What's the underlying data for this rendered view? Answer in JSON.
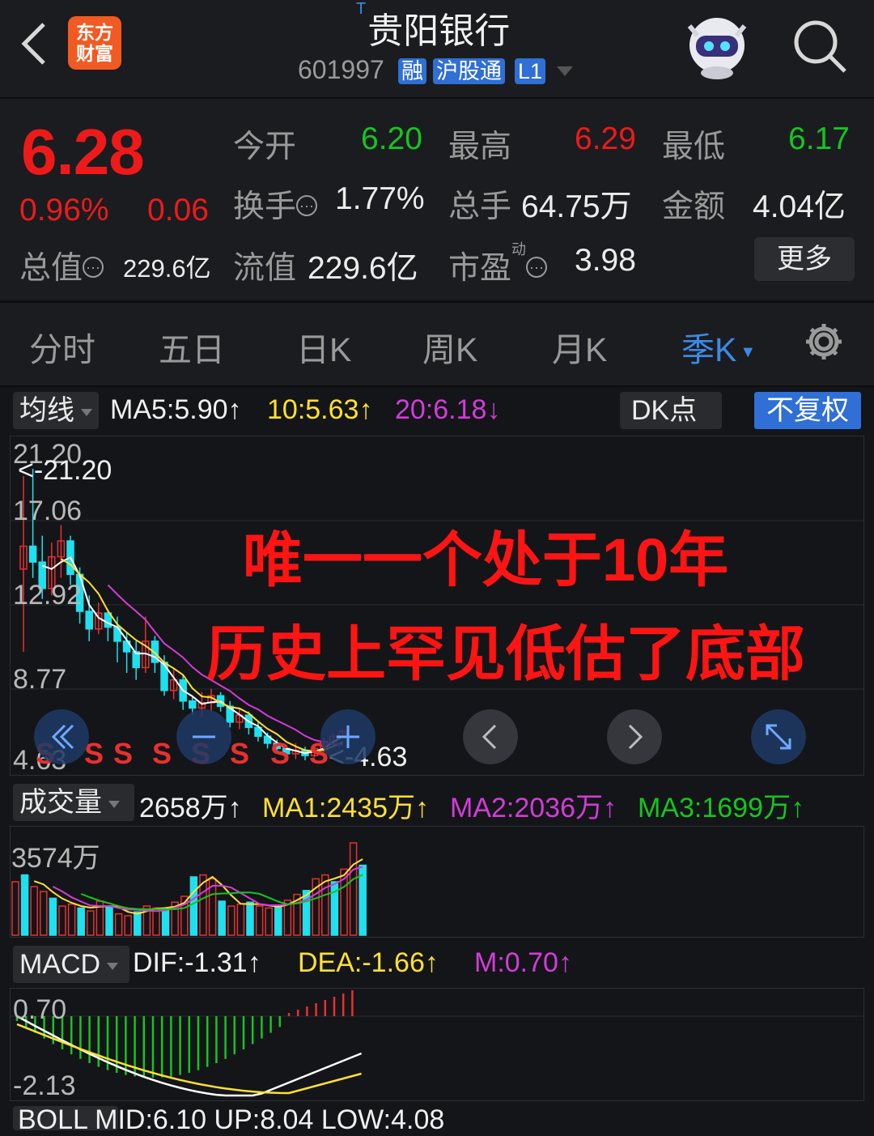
{
  "header": {
    "back_icon": "chevron-left-icon",
    "logo_line1": "东方",
    "logo_line2": "财富",
    "title_mark": "T",
    "title": "贵阳银行",
    "code": "601997",
    "tags": [
      "融",
      "沪股通",
      "L1"
    ],
    "assistant_icon": "robot-assistant-icon",
    "search_icon": "search-icon"
  },
  "quote": {
    "price": "6.28",
    "change_pct": "0.96%",
    "change": "0.06",
    "open_label": "今开",
    "open": "6.20",
    "high_label": "最高",
    "high": "6.29",
    "low_label": "最低",
    "low": "6.17",
    "turnover_label": "换手",
    "turnover": "1.77%",
    "volume_label": "总手",
    "volume": "64.75万",
    "amount_label": "金额",
    "amount": "4.04亿",
    "mcap_label": "总值",
    "mcap": "229.6亿",
    "float_label": "流值",
    "float_cap": "229.6亿",
    "pe_label": "市盈",
    "pe_sup": "动",
    "pe": "3.98",
    "info_glyph": "⋯",
    "more": "更多"
  },
  "tabs": [
    "分时",
    "五日",
    "日K",
    "周K",
    "月K",
    "季K"
  ],
  "active_tab": "季K",
  "ma": {
    "selector": "均线",
    "ma5": "MA5:5.90",
    "ma10": "10:5.63",
    "ma20": "20:6.18",
    "up": "↑",
    "down": "↓",
    "dk": "DK点",
    "adjust": "不复权"
  },
  "kline": {
    "axis": [
      "21.20",
      "17.06",
      "12.92",
      "8.77",
      "4.63"
    ],
    "max_marker": "<-21.20",
    "min_marker": "<-4.63",
    "annotation_line1": "唯一一个处于10年",
    "annotation_line2": "历史上罕见低估了底部",
    "signal": "S",
    "colors": {
      "up": "#e83030",
      "down": "#1fe0ee",
      "ma5": "#ffffff",
      "ma10": "#ffe033",
      "ma20": "#d23cd8"
    }
  },
  "volume": {
    "selector": "成交量",
    "vol": "2658万",
    "ma1": "MA1:2435万",
    "ma2": "MA2:2036万",
    "ma3": "MA3:1699万",
    "axis_top": "3574万"
  },
  "macd": {
    "selector": "MACD",
    "dif": "DIF:-1.31",
    "dea": "DEA:-1.66",
    "m": "M:0.70",
    "axis_top": "0.70",
    "axis_bottom": "-2.13"
  },
  "boll_cut": "BOLL  MID:6.10  UP:8.04  LOW:4.08"
}
